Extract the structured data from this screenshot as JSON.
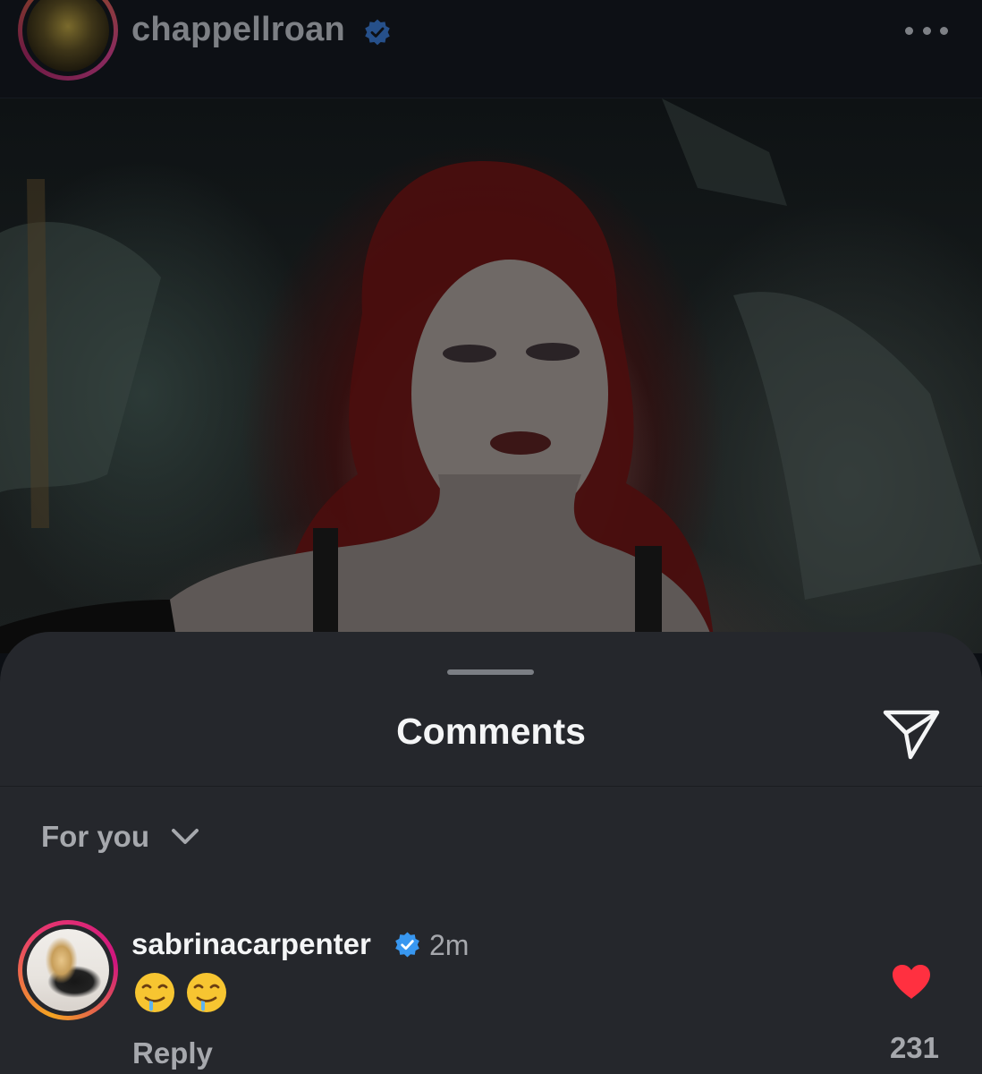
{
  "header": {
    "username": "chappellroan",
    "verified": true,
    "more_icon": "more-horizontal-icon"
  },
  "sheet": {
    "title": "Comments",
    "share_icon": "send-icon",
    "filter": {
      "label": "For you",
      "icon": "chevron-down-icon"
    }
  },
  "comments": [
    {
      "username": "sabrinacarpenter",
      "verified": true,
      "time": "2m",
      "text": "🤤🤤",
      "reply_label": "Reply",
      "like_count": "231",
      "liked": true
    }
  ],
  "colors": {
    "verified": "#3897f0",
    "like": "#ff3040",
    "sheet_bg": "#25272c"
  }
}
